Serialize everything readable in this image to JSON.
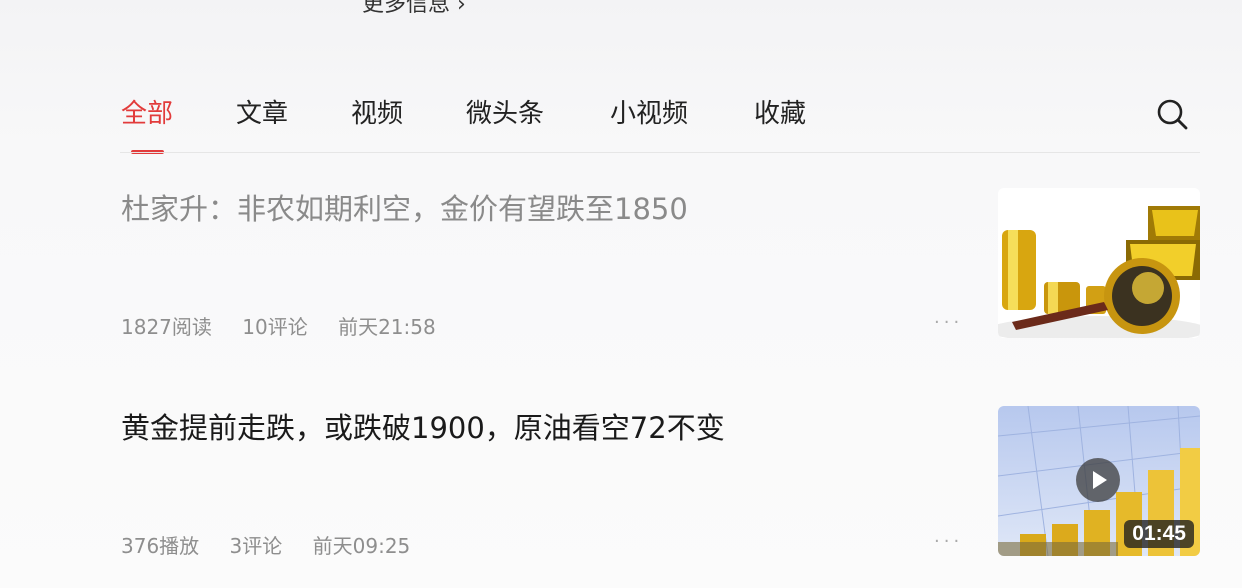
{
  "header": {
    "more_info_label": "更多信息 ›"
  },
  "tabs": [
    {
      "label": "全部",
      "active": true
    },
    {
      "label": "文章",
      "active": false
    },
    {
      "label": "视频",
      "active": false
    },
    {
      "label": "微头条",
      "active": false
    },
    {
      "label": "小视频",
      "active": false
    },
    {
      "label": "收藏",
      "active": false
    }
  ],
  "search": {
    "icon": "search-icon"
  },
  "accent_color": "#e23b3b",
  "feed": [
    {
      "title": "杜家升：非农如期利空，金价有望跌至1850",
      "views": "1827阅读",
      "comments": "10评论",
      "time": "前天21:58",
      "more": "···",
      "thumbnail": "gold-bars-magnifier-image"
    },
    {
      "title": "黄金提前走跌，或跌破1900，原油看空72不变",
      "views": "376播放",
      "comments": "3评论",
      "time": "前天09:25",
      "more": "···",
      "thumbnail": "gold-bar-chart-video",
      "duration": "01:45"
    }
  ]
}
